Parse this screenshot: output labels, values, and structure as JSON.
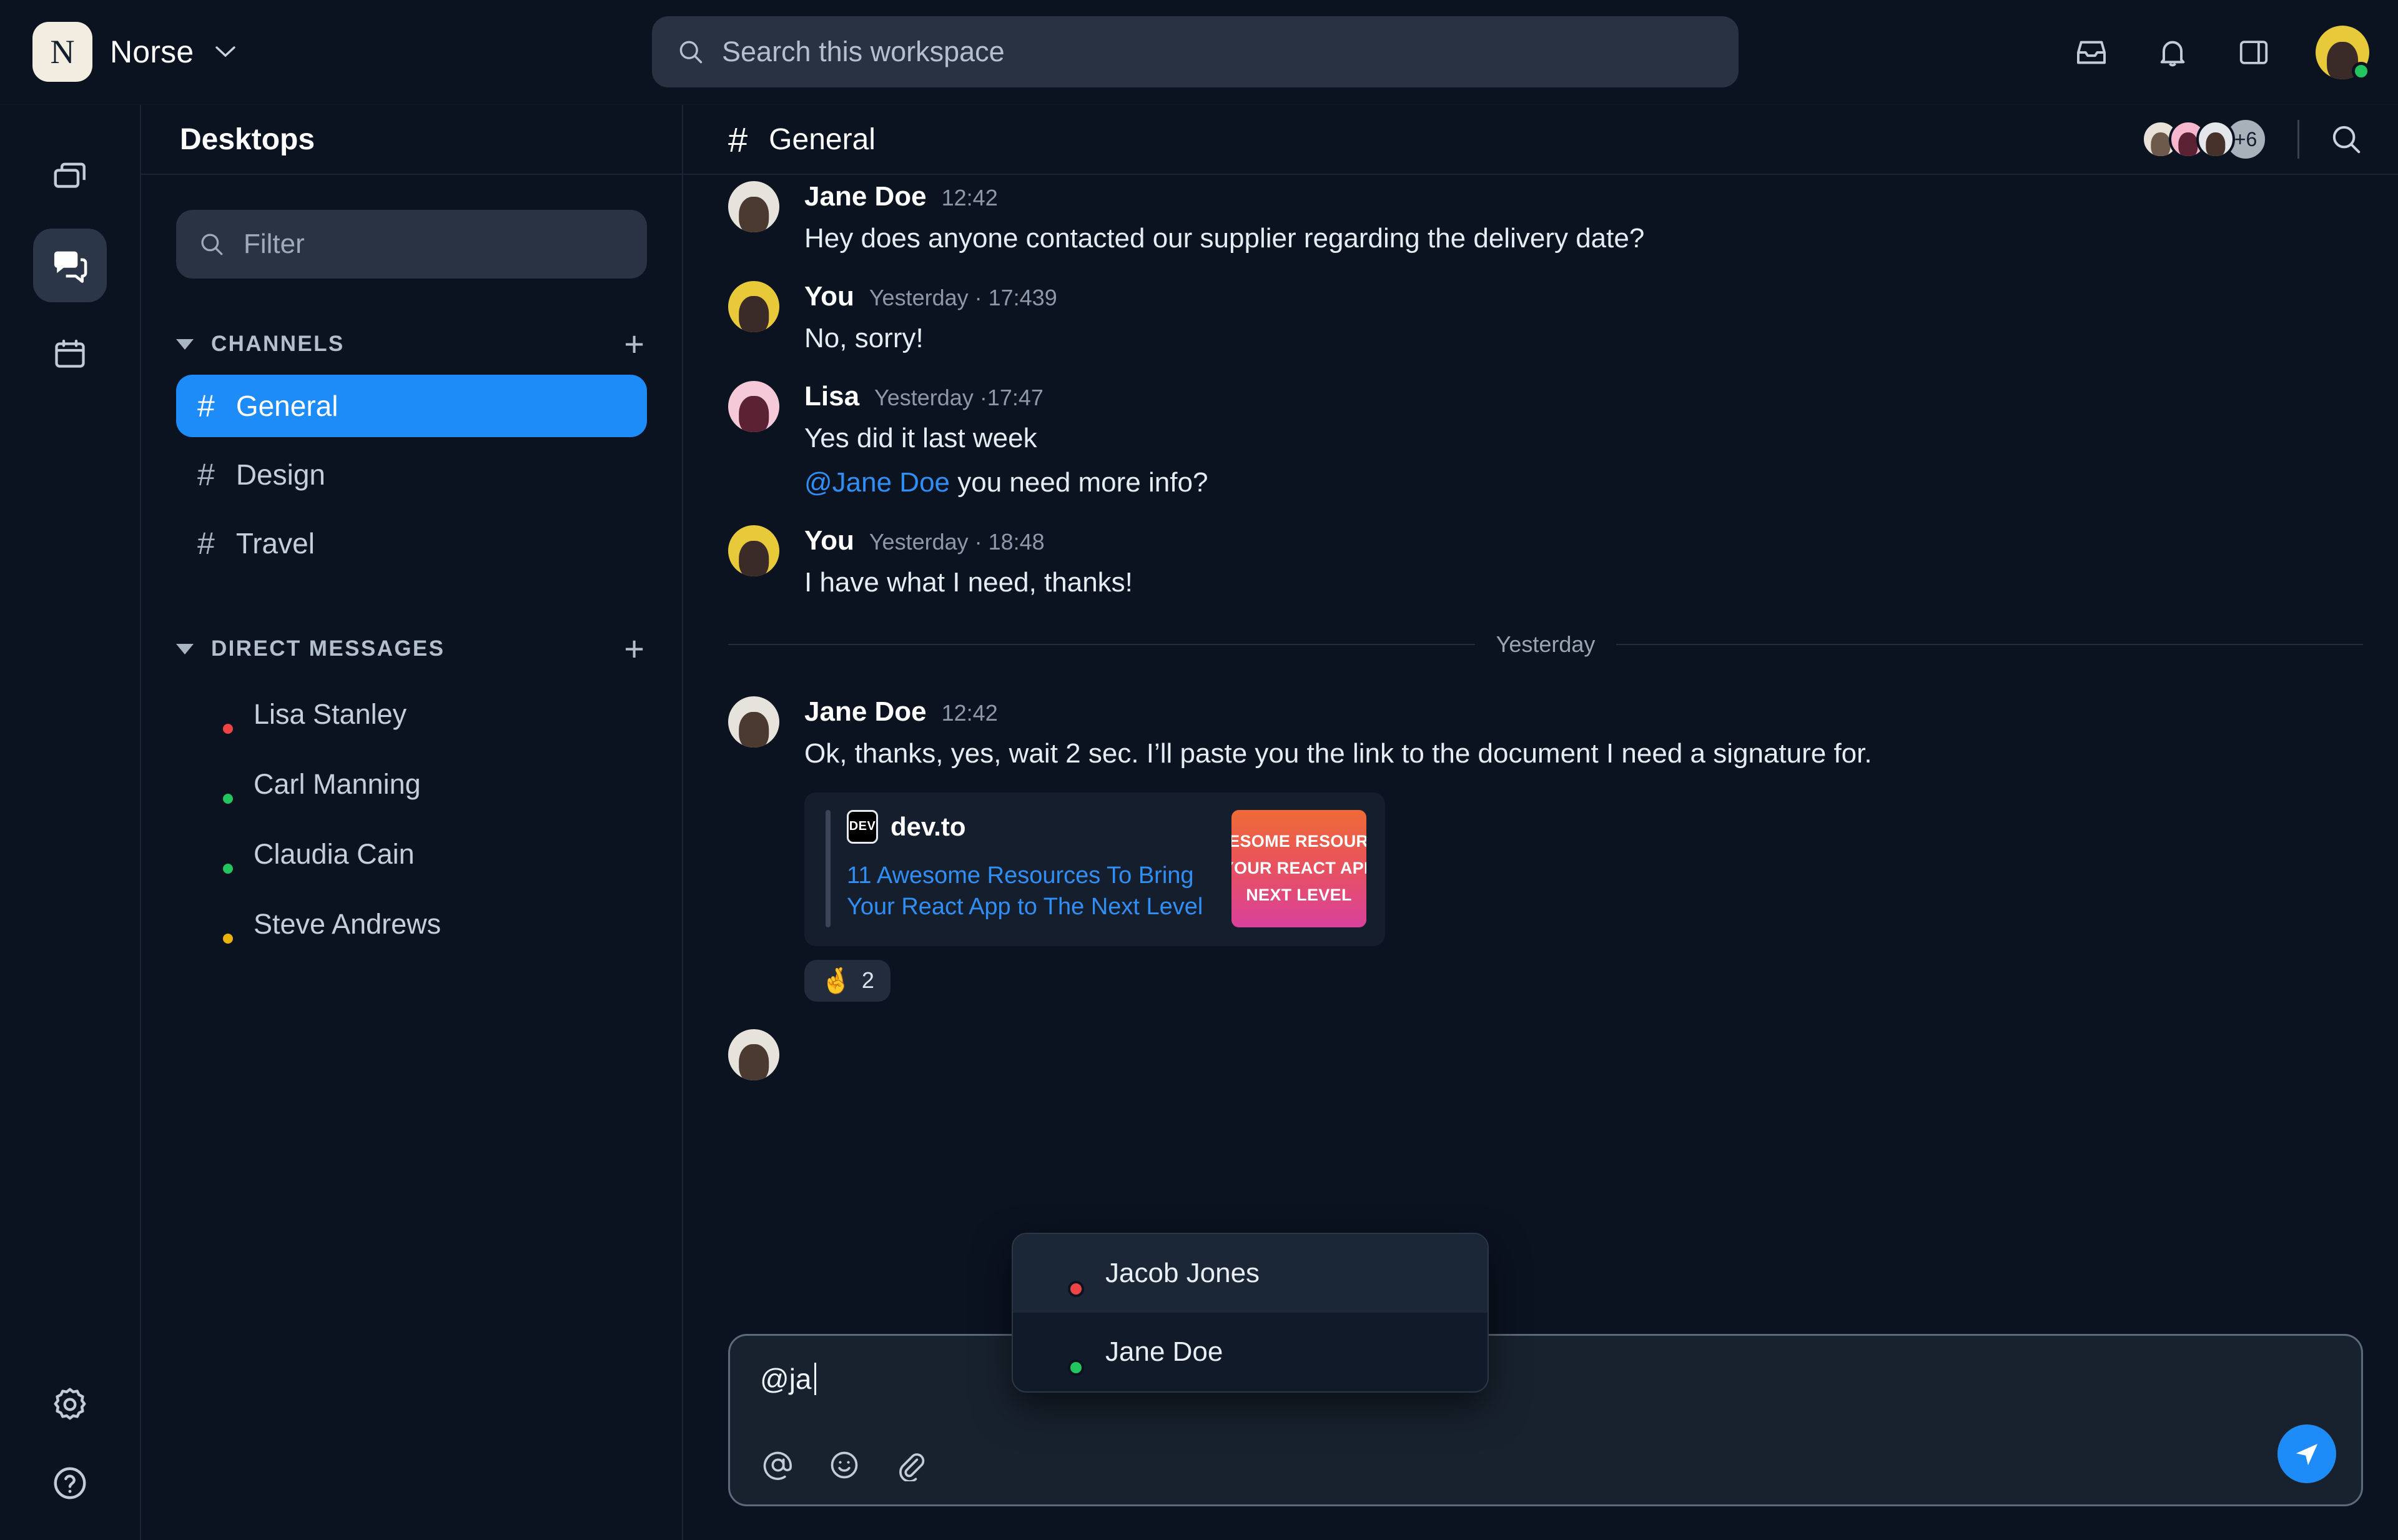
{
  "topbar": {
    "workspace_initial": "N",
    "workspace_name": "Norse",
    "caret": "⌄",
    "search_placeholder": "Search this workspace",
    "icons": [
      "inbox-icon",
      "bell-icon",
      "panel-icon"
    ]
  },
  "rail": {
    "items": [
      {
        "name": "desktops-icon",
        "active": false
      },
      {
        "name": "chat-icon",
        "active": true
      },
      {
        "name": "calendar-icon",
        "active": false
      }
    ],
    "bottom": [
      {
        "name": "settings-icon"
      },
      {
        "name": "help-icon"
      }
    ]
  },
  "sidebar": {
    "title": "Desktops",
    "filter_placeholder": "Filter",
    "channels_label": "CHANNELS",
    "channels_add": "+",
    "channels": [
      {
        "hash": "#",
        "label": "General",
        "active": true
      },
      {
        "hash": "#",
        "label": "Design",
        "active": false
      },
      {
        "hash": "#",
        "label": "Travel",
        "active": false
      }
    ],
    "dm_label": "DIRECT MESSAGES",
    "dm_add": "+",
    "dms": [
      {
        "name": "Lisa Stanley",
        "status": "red",
        "av": "pink"
      },
      {
        "name": "Carl Manning",
        "status": "green",
        "av": "yellow"
      },
      {
        "name": "Claudia Cain",
        "status": "green",
        "av": "orange"
      },
      {
        "name": "Steve Andrews",
        "status": "yellow",
        "av": "purple"
      }
    ]
  },
  "chat": {
    "hash": "#",
    "title": "General",
    "members_overflow": "+6",
    "search_icon": "search-icon",
    "divider_label": "Yesterday",
    "messages": [
      {
        "author": "Jane Doe",
        "time": "12:42",
        "text": "Hey does anyone contacted our supplier regarding the delivery date?",
        "av": "light"
      },
      {
        "author": "You",
        "time": "Yesterday · 17:439",
        "text": "No, sorry!",
        "av": "yellow"
      },
      {
        "author": "Lisa",
        "time": "Yesterday ·17:47",
        "text": "Yes did it last week",
        "mention": "@Jane Doe",
        "text2": " you need more info?",
        "av": "pink"
      },
      {
        "author": "You",
        "time": "Yesterday · 18:48",
        "text": "I have what I need, thanks!",
        "av": "yellow"
      },
      {
        "author": "Jane Doe",
        "time": "12:42",
        "text": "Ok, thanks, yes, wait 2 sec. I’ll paste you the link to the document I need a signature for.",
        "av": "light"
      }
    ],
    "link_card": {
      "logo_text": "DEV",
      "source": "dev.to",
      "title": "11 Awesome Resources To Bring Your React App to The Next Level",
      "thumb_lines": [
        "VESOME RESOURC",
        "YOUR REACT APP",
        "NEXT LEVEL"
      ]
    },
    "reaction": {
      "emoji": "🤞",
      "count": "2"
    }
  },
  "mention_dropdown": {
    "items": [
      {
        "name": "Jacob Jones",
        "status": "red",
        "av": "dark",
        "highlighted": true
      },
      {
        "name": "Jane Doe",
        "status": "green",
        "av": "light",
        "highlighted": false
      }
    ]
  },
  "composer": {
    "value": "@ja",
    "tools": [
      "mention-icon",
      "emoji-icon",
      "attachment-icon"
    ],
    "send": "send-icon"
  },
  "colors": {
    "accent": "#1d8bf8",
    "link": "#2f8ff5",
    "background": "#0b1220",
    "panel": "#151e2d",
    "status_online": "#22c55e",
    "status_busy": "#ef4444",
    "status_away": "#eab308"
  }
}
